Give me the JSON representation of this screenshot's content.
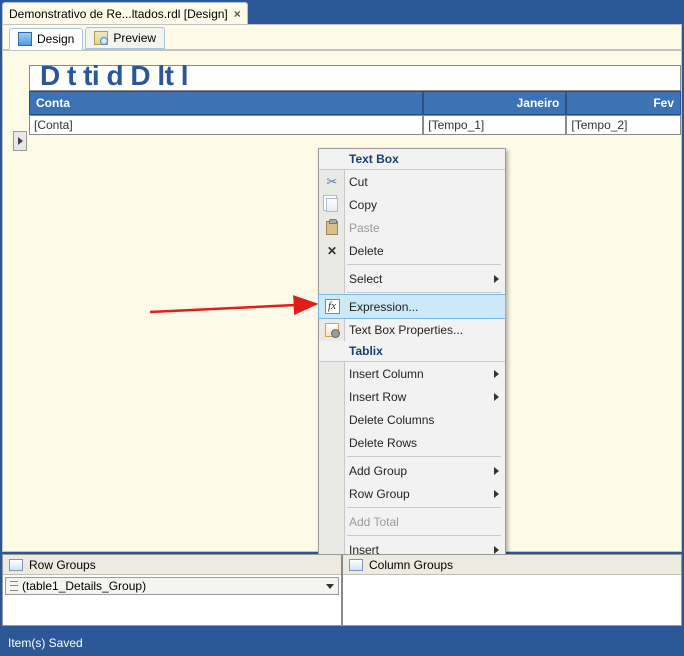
{
  "file_tab": {
    "name": "Demonstrativo de Re...ltados.rdl [Design]"
  },
  "tabs": {
    "design": "Design",
    "preview": "Preview"
  },
  "report": {
    "title_fragment": "D                           t      ti           d      D           lt       l",
    "columns": {
      "conta": "Conta",
      "jan": "Janeiro",
      "fev": "Fev"
    },
    "cells": {
      "conta": "[Conta]",
      "t1": "[Tempo_1]",
      "t2": "[Tempo_2]"
    }
  },
  "context_menu": {
    "section_textbox": "Text Box",
    "cut": "Cut",
    "copy": "Copy",
    "paste": "Paste",
    "delete": "Delete",
    "select": "Select",
    "expression": "Expression...",
    "tb_props": "Text Box Properties...",
    "section_tablix": "Tablix",
    "insert_col": "Insert Column",
    "insert_row": "Insert Row",
    "del_cols": "Delete Columns",
    "del_rows": "Delete Rows",
    "add_group": "Add Group",
    "row_group": "Row Group",
    "add_total": "Add Total",
    "insert": "Insert"
  },
  "groups": {
    "row_label": "Row Groups",
    "col_label": "Column Groups",
    "details_name": "(table1_Details_Group)"
  },
  "status": "Item(s) Saved"
}
